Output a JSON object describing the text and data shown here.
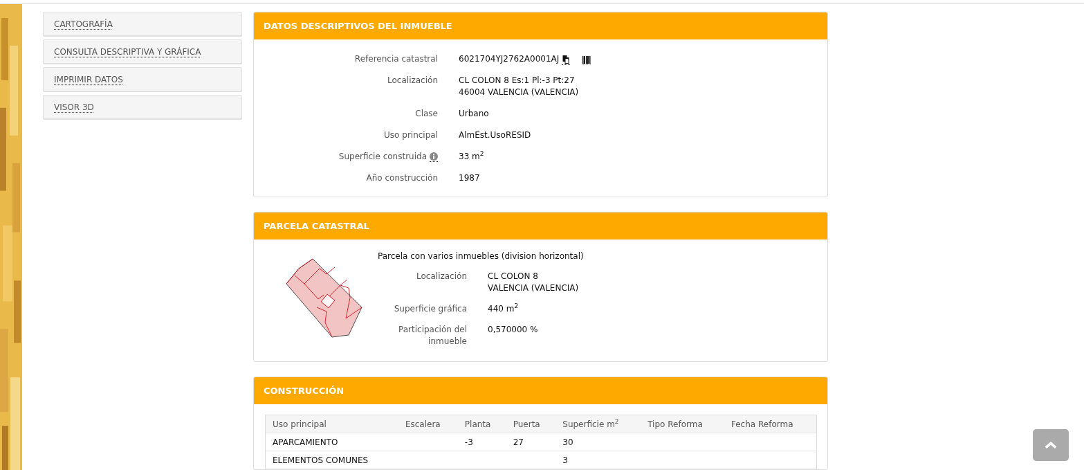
{
  "sidebar": {
    "items": [
      {
        "label": "CARTOGRAFÍA"
      },
      {
        "label": "CONSULTA DESCRIPTIVA Y GRÁFICA"
      },
      {
        "label": "IMPRIMIR DATOS"
      },
      {
        "label": "VISOR 3D"
      }
    ]
  },
  "sections": [
    {
      "kind": "fields",
      "title": "DATOS DESCRIPTIVOS DEL INMUEBLE",
      "fields": [
        {
          "kind": "reference",
          "label": "Referencia catastral",
          "value": [
            "6021704YJ2762A0001AJ"
          ]
        },
        {
          "kind": "plain",
          "label": "Localización",
          "value": [
            "CL COLON 8 Es:1 Pl:-3 Pt:27",
            "46004 VALENCIA (VALENCIA)"
          ]
        },
        {
          "kind": "plain",
          "label": "Clase",
          "value": [
            "Urbano"
          ]
        },
        {
          "kind": "plain",
          "label": "Uso principal",
          "value": [
            "AlmEst.UsoRESID"
          ]
        },
        {
          "kind": "info",
          "label": "Superficie construida",
          "value": [
            "33 m$^{2}$"
          ]
        },
        {
          "kind": "plain",
          "label": "Año construcción",
          "value": [
            "1987"
          ]
        }
      ]
    },
    {
      "kind": "parcel",
      "title": "PARCELA CATASTRAL",
      "caption": "Parcela con varios inmuebles (division horizontal)",
      "fields": [
        {
          "kind": "plain",
          "label": "Localización",
          "value": [
            "CL COLON 8",
            "VALENCIA (VALENCIA)"
          ]
        },
        {
          "kind": "plain",
          "label": "Superficie gráfica",
          "value": [
            "440 m$^{2}$"
          ]
        },
        {
          "kind": "plain",
          "label": "Participación del inmueble",
          "value": [
            "0,570000 %"
          ]
        }
      ]
    },
    {
      "kind": "table",
      "title": "CONSTRUCCIÓN",
      "columns": [
        "Uso principal",
        "Escalera",
        "Planta",
        "Puerta",
        "Superficie m$^{2}$",
        "Tipo Reforma",
        "Fecha Reforma"
      ],
      "rows": [
        [
          "APARCAMIENTO",
          "",
          "-3",
          "27",
          "30",
          "",
          ""
        ],
        [
          "ELEMENTOS COMUNES",
          "",
          "",
          "",
          "3",
          "",
          ""
        ]
      ]
    }
  ]
}
